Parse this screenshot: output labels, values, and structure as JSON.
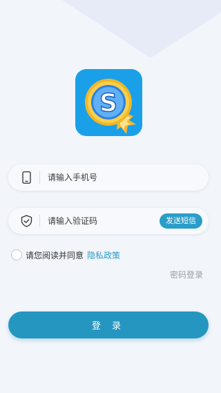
{
  "colors": {
    "accent": "#2596c0",
    "link": "#2a9dc8",
    "background": "#f2f5fa",
    "logo_bg": "#1aa0e8",
    "logo_ring": "#f0b629"
  },
  "icons": {
    "logo": "s-coin-rocket-logo",
    "phone_field": "smartphone-icon",
    "code_field": "shield-check-icon"
  },
  "phone": {
    "placeholder": "请输入手机号",
    "value": ""
  },
  "code": {
    "placeholder": "请输入验证码",
    "value": "",
    "send_label": "发送短信"
  },
  "agreement": {
    "checked": false,
    "text": "请您阅读并同意",
    "link_label": "隐私政策"
  },
  "password_login_label": "密码登录",
  "login_label": "登 录"
}
